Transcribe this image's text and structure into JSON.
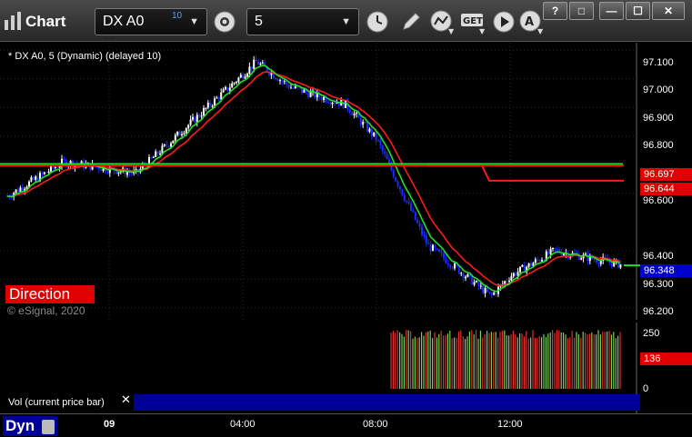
{
  "app": {
    "title": "Chart"
  },
  "toolbar": {
    "symbol": "DX A0",
    "symbol_badge": "10",
    "interval": "5",
    "get_label": "GET",
    "window_buttons": [
      "?",
      "□",
      "—",
      "☐",
      "✕"
    ]
  },
  "chart_header": "* DX A0, 5 (Dynamic) (delayed 10)",
  "direction_label": "Direction",
  "watermark": "© eSignal, 2020",
  "price_axis": [
    "97.100",
    "97.000",
    "96.900",
    "96.800",
    "96.600",
    "96.400",
    "96.300",
    "96.200"
  ],
  "price_tags": [
    {
      "value": "96.697",
      "color": "#e00000"
    },
    {
      "value": "96.644",
      "color": "#e00000"
    },
    {
      "value": "96.348",
      "color": "#0000cc"
    }
  ],
  "volume": {
    "label": "Vol (current price bar)",
    "axis": [
      "250",
      "0"
    ],
    "tag": {
      "value": "136",
      "color": "#e00000"
    }
  },
  "time_axis": [
    "09",
    "04:00",
    "08:00",
    "12:00"
  ],
  "bottom_label": "Dyn",
  "colors": {
    "up_bar": "#ffffff",
    "down_bar": "#1a2bff",
    "ema_red": "#ff1a1a",
    "ema_green": "#22e022",
    "vol_up": "#7ccf5a",
    "vol_down": "#e03030"
  },
  "chart_data": {
    "type": "candlestick",
    "x_ticks": [
      "09",
      "04:00",
      "08:00",
      "12:00"
    ],
    "ylim": [
      96.18,
      97.12
    ],
    "horizontal_levels": [
      96.697,
      96.644
    ],
    "last_price": 96.348,
    "approx_path": [
      [
        "09",
        96.59
      ],
      [
        "02:00",
        96.71
      ],
      [
        "03:00",
        96.67
      ],
      [
        "04:00",
        97.06
      ],
      [
        "05:00",
        96.97
      ],
      [
        "07:00",
        96.91
      ],
      [
        "08:00",
        96.79
      ],
      [
        "09:00",
        96.42
      ],
      [
        "11:00",
        96.24
      ],
      [
        "12:00",
        96.31
      ],
      [
        "13:00",
        96.4
      ],
      [
        "14:00",
        96.35
      ]
    ]
  }
}
